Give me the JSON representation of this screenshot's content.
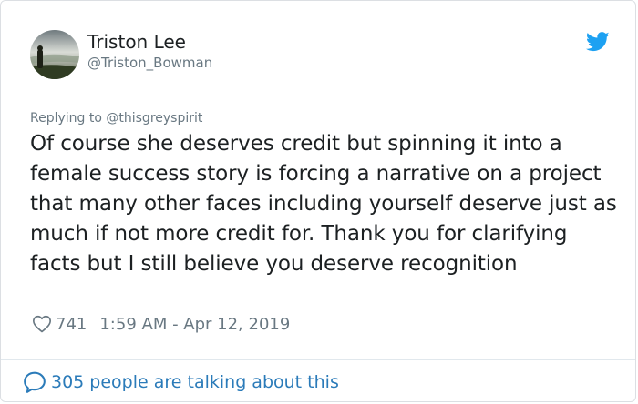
{
  "tweet": {
    "author_name": "Triston Lee",
    "author_handle": "@Triston_Bowman",
    "reply_prefix": "Replying to",
    "reply_handle": "@thisgreyspirit",
    "text": "Of course she deserves credit but spinning it into a female success story is forcing a narrative on a project that many other faces including yourself deserve just as much if not more credit for. Thank you for clarifying facts but I still believe you deserve recognition",
    "likes": "741",
    "timestamp": "1:59 AM - Apr 12, 2019"
  },
  "footer": {
    "conversation_label": "305 people are talking about this"
  },
  "icons": {
    "brand": "twitter-bird-icon",
    "like": "heart-icon",
    "conversation": "speech-bubble-icon"
  },
  "colors": {
    "brand_blue": "#1da1f2",
    "link_blue": "#2b7bb9",
    "secondary_text": "#697882",
    "primary_text": "#1c2022"
  }
}
